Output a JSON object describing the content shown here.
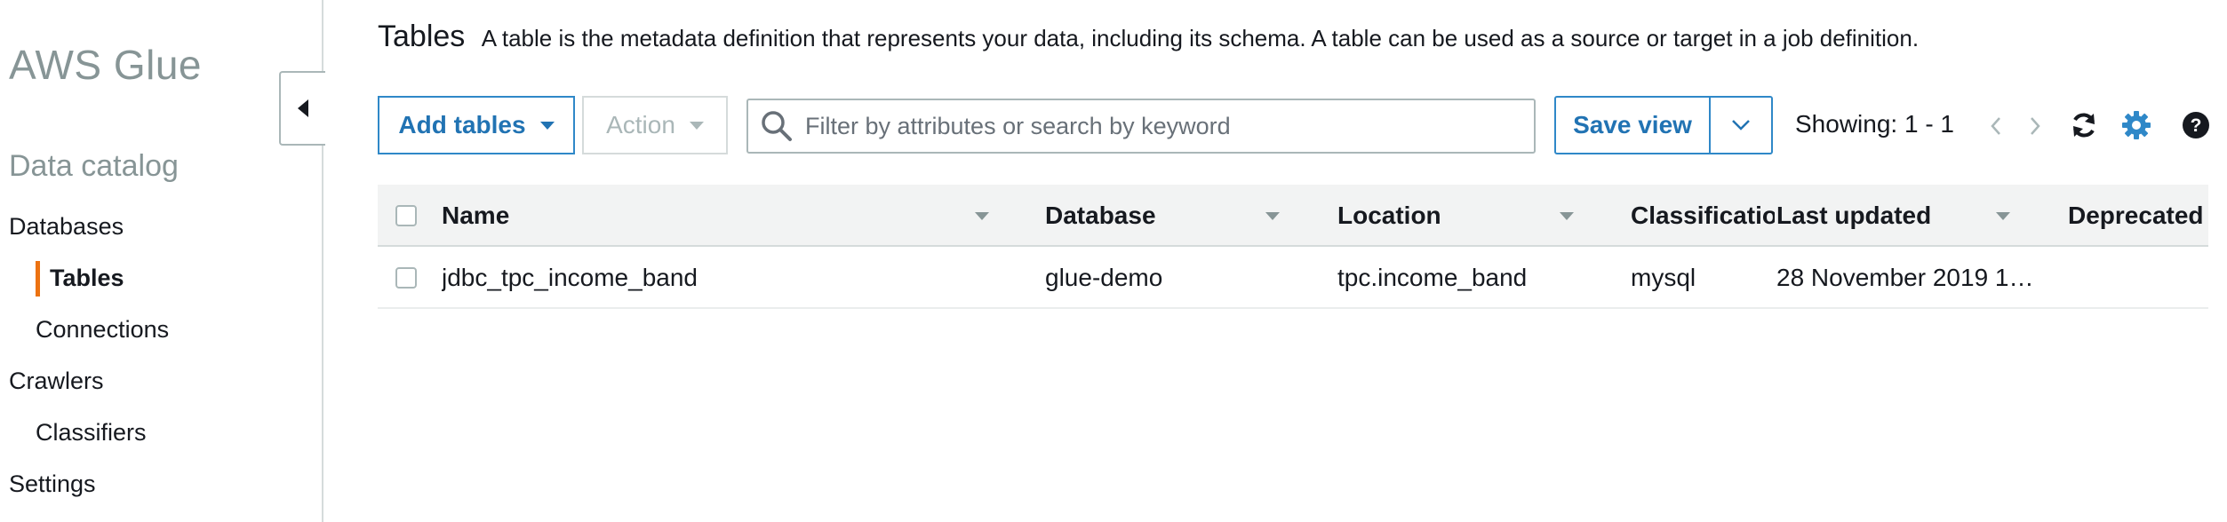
{
  "sidebar": {
    "brand": "AWS Glue",
    "section_title": "Data catalog",
    "items": [
      {
        "label": "Databases"
      },
      {
        "label": "Tables"
      },
      {
        "label": "Connections"
      },
      {
        "label": "Crawlers"
      },
      {
        "label": "Classifiers"
      },
      {
        "label": "Settings"
      }
    ],
    "active_color": "#ec7211"
  },
  "header": {
    "title": "Tables",
    "description": "A table is the metadata definition that represents your data, including its schema. A table can be used as a source or target in a job definition."
  },
  "toolbar": {
    "add_tables_label": "Add tables",
    "action_label": "Action",
    "search_placeholder": "Filter by attributes or search by keyword",
    "save_view_label": "Save view",
    "showing_text": "Showing: 1 - 1",
    "prev_icon": "chevron-left-icon",
    "next_icon": "chevron-right-icon",
    "refresh_icon": "refresh-icon",
    "settings_icon": "gear-icon",
    "help_icon": "help-icon"
  },
  "table": {
    "columns": [
      "Name",
      "Database",
      "Location",
      "Classification",
      "Last updated",
      "Deprecated"
    ],
    "rows": [
      {
        "name": "jdbc_tpc_income_band",
        "database": "glue-demo",
        "location": "tpc.income_band",
        "classification": "mysql",
        "last_updated": "28 November 2019 1…",
        "deprecated": ""
      }
    ]
  },
  "colors": {
    "accent": "#2173b3",
    "accent_border": "#2f88c8",
    "muted": "#879596",
    "disabled": "#aab7b8"
  }
}
